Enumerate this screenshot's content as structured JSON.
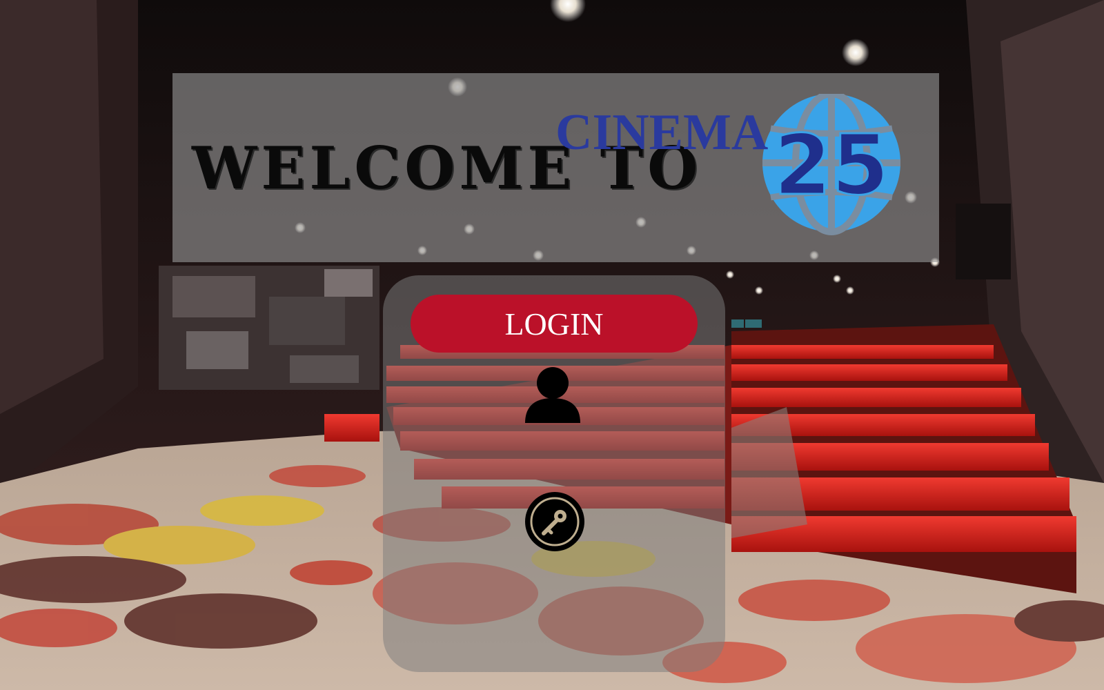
{
  "page": {
    "background_scene": "cinema-auditorium",
    "seat_color": "#e0251f",
    "carpet_tones": [
      "#c8b8a8",
      "#b53a30",
      "#d8b730",
      "#5a2c28"
    ]
  },
  "banner": {
    "welcome_text": "WELCOME TO",
    "logo": {
      "word": "CINEMA",
      "number": "25",
      "word_color": "#2a3a9e",
      "number_color": "#1f2f8c",
      "globe_color": "#3aa3e8",
      "icon": "globe-icon"
    }
  },
  "login": {
    "header_label": "LOGIN",
    "header_color": "#bb1129",
    "user_icon": "user-icon",
    "password_icon": "key-icon"
  }
}
